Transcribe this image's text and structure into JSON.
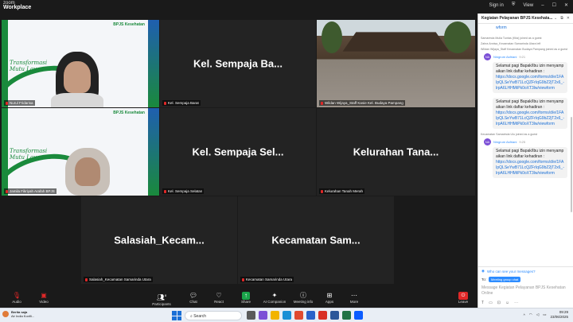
{
  "app": {
    "brand_line1": "zoom",
    "brand_line2": "Workplace"
  },
  "topbar": {
    "sign_in": "Sign in",
    "view": "View"
  },
  "tiles": [
    {
      "name": "Nurul Fridarisa",
      "kind": "video"
    },
    {
      "name": "Kel. Sempaja Ba...",
      "tag": "Kel. Sempaja Barat",
      "kind": "name"
    },
    {
      "name": "Wildan Wijaya_Staff Kecamatan Sungai Pinang",
      "tag": "Wildan Wijaya_Staff Kasie Kel. Budaya Pampang",
      "kind": "photo"
    },
    {
      "name": "Jamila Fikriyah",
      "tag": "Jamila Fikriyah Arafah BPJS",
      "kind": "video"
    },
    {
      "name": "Kel. Sempaja Sel...",
      "tag": "Kel. Sempaja Selatan",
      "kind": "name"
    },
    {
      "name": "Kelurahan  Tana...",
      "tag": "Kelurahan Tanah Merah",
      "kind": "name"
    },
    {
      "name": "Salasiah_Kecam...",
      "tag": "Salasiah_Kecamatan Samarinda Utara",
      "kind": "name"
    },
    {
      "name": "Kecamatan  Sam...",
      "tag": "Kecamatan Samarinda Utara",
      "kind": "name"
    }
  ],
  "slide": {
    "logo": "BPJS Kesehatan",
    "tagline": "Transformasi Mutu Layanan"
  },
  "chat": {
    "title": "Kegiatan Pelayanan BPJS Kesehata...",
    "top_link": "wform",
    "system": [
      "Samarinda Mulia Tuntas (Kita) joined as a guest",
      "Zahra Annisa_Kecamatan Samarinda Utara left",
      "Wildan Wijaya_Staff Kecamatan Budaya Pampang joined as a guest"
    ],
    "sender1": {
      "initials": "NA",
      "name": "Ningrum Asfriani",
      "time": "9:21"
    },
    "messages1": [
      {
        "text": "Selamat pagi Bapak/Ibu izin menyampaikan link daftar kehadiran :",
        "link": "https://docs.google.com/forms/d/e/1FAIpQLSeYwB71LcQZFrIqG9bZ2jT2x6_-lrpA6LHHMtPk0oXT3lw/viewform"
      },
      {
        "text": "Selamat pagi Bapak/Ibu izin menyampaikan link daftar kehadiran :",
        "link": "https://docs.google.com/forms/d/e/1FAIpQLSeYwB71LcQZFrIqG9bZ2jT2x6_-lrpA6LHHMtPk0oXT3lw/viewform"
      }
    ],
    "system2": "Kecamatan Samarinda Ulu joined as a guest",
    "sender2": {
      "initials": "NA",
      "name": "Ningrum Asfriani",
      "time": "9:25"
    },
    "messages2": [
      {
        "text": "Selamat pagi Bapak/Ibu izin menyampaikan link daftar kehadiran :",
        "link": "https://docs.google.com/forms/d/e/1FAIpQLSeYwB71LcQZFrIqG9bZ2jT2x6_-lrpA6LHHMtPk0oXT3lw/viewform"
      }
    ],
    "who_can_see": "Who can see your messages?",
    "to_label": "To:",
    "to_value": "Meeting group chat",
    "placeholder": "Message Kegiatan Pelayanan BPJS Kesehatan Online"
  },
  "toolbar": {
    "audio": "Audio",
    "video": "Video",
    "participants": "Participants",
    "participants_count": "8",
    "chat": "Chat",
    "react": "React",
    "share": "Share",
    "ai": "AI Companion",
    "info": "Meeting info",
    "apps": "Apps",
    "more": "More",
    "leave": "Leave"
  },
  "taskbar": {
    "weather_title": "Berita saja",
    "weather_sub": "Air India Konfli...",
    "search": "Search",
    "time": "09:29",
    "date": "23/06/2025"
  },
  "colors": {
    "accent": "#2d8cff",
    "leave": "#e02828",
    "share": "#1aa34a",
    "bpjs_green": "#1a8a3c"
  }
}
